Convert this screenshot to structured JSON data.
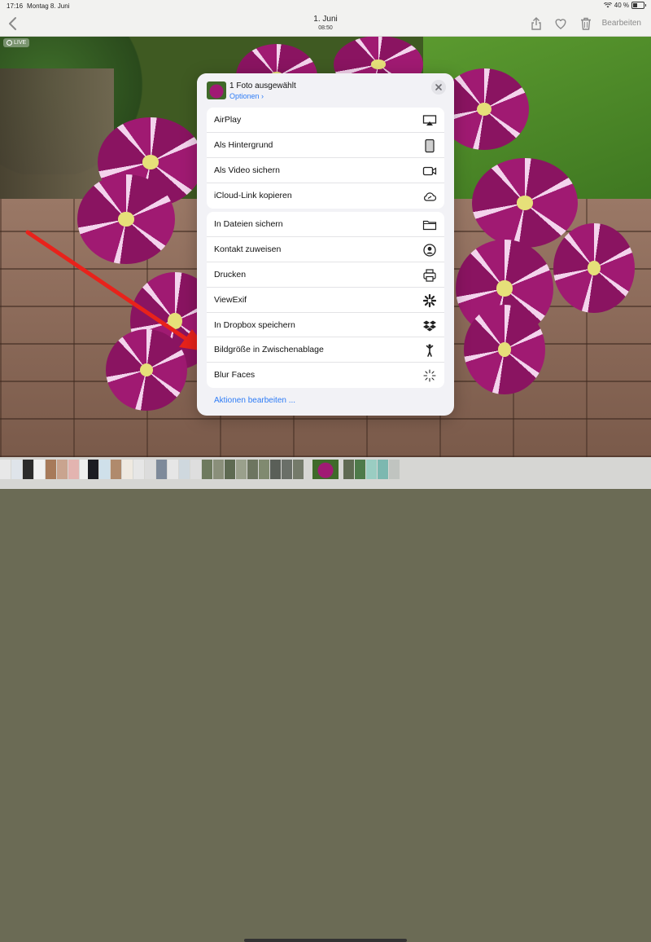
{
  "status_bar": {
    "time": "17:16",
    "date": "Montag 8. Juni",
    "battery": "40 %"
  },
  "navbar": {
    "title": "1. Juni",
    "subtitle": "08:50",
    "edit_label": "Bearbeiten"
  },
  "live_badge": "LIVE",
  "share_sheet": {
    "title": "1 Foto ausgewählt",
    "options_label": "Optionen",
    "group1": [
      {
        "label": "AirPlay",
        "icon": "airplay-icon"
      },
      {
        "label": "Als Hintergrund",
        "icon": "wallpaper-icon"
      },
      {
        "label": "Als Video sichern",
        "icon": "video-icon"
      },
      {
        "label": "iCloud-Link kopieren",
        "icon": "icloud-link-icon"
      }
    ],
    "group2": [
      {
        "label": "In Dateien sichern",
        "icon": "folder-icon"
      },
      {
        "label": "Kontakt zuweisen",
        "icon": "contact-icon"
      },
      {
        "label": "Drucken",
        "icon": "printer-icon"
      },
      {
        "label": "ViewExif",
        "icon": "viewexif-icon"
      },
      {
        "label": "In Dropbox speichern",
        "icon": "dropbox-icon"
      },
      {
        "label": "Bildgröße in Zwischenablage",
        "icon": "shortcut-figure-icon"
      },
      {
        "label": "Blur Faces",
        "icon": "sparkle-icon"
      }
    ],
    "edit_actions_label": "Aktionen bearbeiten ..."
  },
  "colors": {
    "accent": "#2e7cf6",
    "sheet_bg": "#f2f2f6",
    "arrow": "#e8221b"
  }
}
